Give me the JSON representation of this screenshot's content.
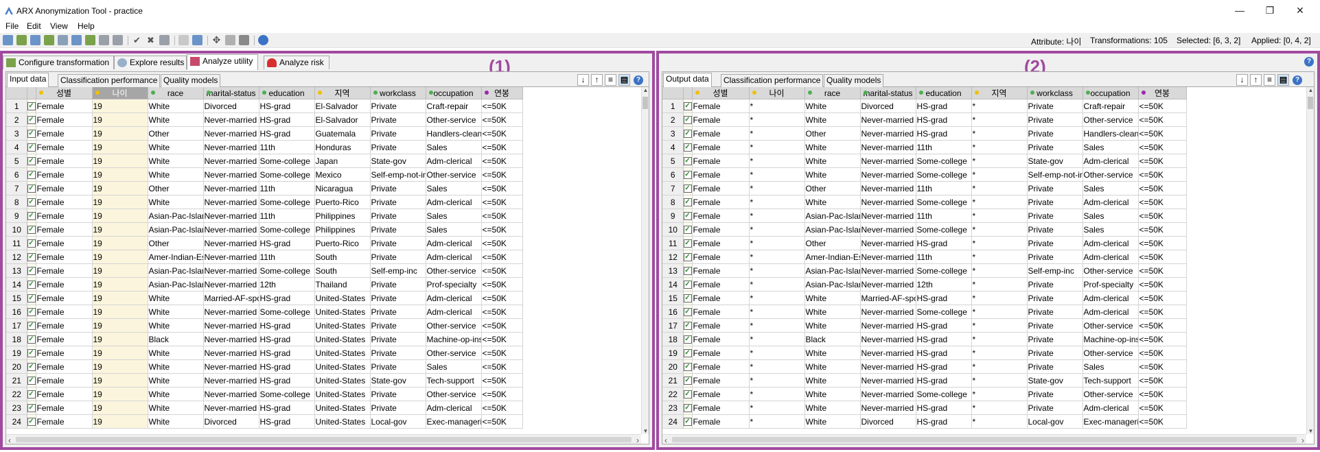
{
  "window": {
    "title": "ARX Anonymization Tool - practice"
  },
  "menu": [
    "File",
    "Edit",
    "View",
    "Help"
  ],
  "status": {
    "attribute": "Attribute: 나이",
    "transformations": "Transformations: 105",
    "selected": "Selected: [6, 3, 2]",
    "applied": "Applied: [0, 4, 2]"
  },
  "tabs": [
    "Configure transformation",
    "Explore results",
    "Analyze utility",
    "Analyze risk"
  ],
  "left": {
    "label": "(1)",
    "subtabs": [
      "Input data",
      "Classification performance",
      "Quality models"
    ]
  },
  "right": {
    "label": "(2)",
    "subtabs": [
      "Output data",
      "Classification performance",
      "Quality models"
    ]
  },
  "columns": [
    "성별",
    "나이",
    "race",
    "marital-status",
    "education",
    "지역",
    "workclass",
    "occupation",
    "연봉"
  ],
  "column_dot_colors": [
    "#f0c000",
    "#f0c000",
    "#4caf50",
    "#4caf50",
    "#4caf50",
    "#f0c000",
    "#4caf50",
    "#4caf50",
    "#9c27b0"
  ],
  "input_rows": [
    [
      "Female",
      "19",
      "White",
      "Divorced",
      "HS-grad",
      "El-Salvador",
      "Private",
      "Craft-repair",
      "<=50K"
    ],
    [
      "Female",
      "19",
      "White",
      "Never-married",
      "HS-grad",
      "El-Salvador",
      "Private",
      "Other-service",
      "<=50K"
    ],
    [
      "Female",
      "19",
      "Other",
      "Never-married",
      "HS-grad",
      "Guatemala",
      "Private",
      "Handlers-cleaners",
      "<=50K"
    ],
    [
      "Female",
      "19",
      "White",
      "Never-married",
      "11th",
      "Honduras",
      "Private",
      "Sales",
      "<=50K"
    ],
    [
      "Female",
      "19",
      "White",
      "Never-married",
      "Some-college",
      "Japan",
      "State-gov",
      "Adm-clerical",
      "<=50K"
    ],
    [
      "Female",
      "19",
      "White",
      "Never-married",
      "Some-college",
      "Mexico",
      "Self-emp-not-inc",
      "Other-service",
      "<=50K"
    ],
    [
      "Female",
      "19",
      "Other",
      "Never-married",
      "11th",
      "Nicaragua",
      "Private",
      "Sales",
      "<=50K"
    ],
    [
      "Female",
      "19",
      "White",
      "Never-married",
      "Some-college",
      "Puerto-Rico",
      "Private",
      "Adm-clerical",
      "<=50K"
    ],
    [
      "Female",
      "19",
      "Asian-Pac-Island...",
      "Never-married",
      "11th",
      "Philippines",
      "Private",
      "Sales",
      "<=50K"
    ],
    [
      "Female",
      "19",
      "Asian-Pac-Island...",
      "Never-married",
      "Some-college",
      "Philippines",
      "Private",
      "Sales",
      "<=50K"
    ],
    [
      "Female",
      "19",
      "Other",
      "Never-married",
      "HS-grad",
      "Puerto-Rico",
      "Private",
      "Adm-clerical",
      "<=50K"
    ],
    [
      "Female",
      "19",
      "Amer-Indian-Esk...",
      "Never-married",
      "11th",
      "South",
      "Private",
      "Adm-clerical",
      "<=50K"
    ],
    [
      "Female",
      "19",
      "Asian-Pac-Island...",
      "Never-married",
      "Some-college",
      "South",
      "Self-emp-inc",
      "Other-service",
      "<=50K"
    ],
    [
      "Female",
      "19",
      "Asian-Pac-Island...",
      "Never-married",
      "12th",
      "Thailand",
      "Private",
      "Prof-specialty",
      "<=50K"
    ],
    [
      "Female",
      "19",
      "White",
      "Married-AF-spo...",
      "HS-grad",
      "United-States",
      "Private",
      "Adm-clerical",
      "<=50K"
    ],
    [
      "Female",
      "19",
      "White",
      "Never-married",
      "Some-college",
      "United-States",
      "Private",
      "Adm-clerical",
      "<=50K"
    ],
    [
      "Female",
      "19",
      "White",
      "Never-married",
      "HS-grad",
      "United-States",
      "Private",
      "Other-service",
      "<=50K"
    ],
    [
      "Female",
      "19",
      "Black",
      "Never-married",
      "HS-grad",
      "United-States",
      "Private",
      "Machine-op-ins...",
      "<=50K"
    ],
    [
      "Female",
      "19",
      "White",
      "Never-married",
      "HS-grad",
      "United-States",
      "Private",
      "Other-service",
      "<=50K"
    ],
    [
      "Female",
      "19",
      "White",
      "Never-married",
      "HS-grad",
      "United-States",
      "Private",
      "Sales",
      "<=50K"
    ],
    [
      "Female",
      "19",
      "White",
      "Never-married",
      "HS-grad",
      "United-States",
      "State-gov",
      "Tech-support",
      "<=50K"
    ],
    [
      "Female",
      "19",
      "White",
      "Never-married",
      "Some-college",
      "United-States",
      "Private",
      "Other-service",
      "<=50K"
    ],
    [
      "Female",
      "19",
      "White",
      "Never-married",
      "HS-grad",
      "United-States",
      "Private",
      "Adm-clerical",
      "<=50K"
    ],
    [
      "Female",
      "19",
      "White",
      "Divorced",
      "HS-grad",
      "United-States",
      "Local-gov",
      "Exec-managerial",
      "<=50K"
    ]
  ],
  "output_rows": [
    [
      "Female",
      "*",
      "White",
      "Divorced",
      "HS-grad",
      "*",
      "Private",
      "Craft-repair",
      "<=50K"
    ],
    [
      "Female",
      "*",
      "White",
      "Never-married",
      "HS-grad",
      "*",
      "Private",
      "Other-service",
      "<=50K"
    ],
    [
      "Female",
      "*",
      "Other",
      "Never-married",
      "HS-grad",
      "*",
      "Private",
      "Handlers-cleaners",
      "<=50K"
    ],
    [
      "Female",
      "*",
      "White",
      "Never-married",
      "11th",
      "*",
      "Private",
      "Sales",
      "<=50K"
    ],
    [
      "Female",
      "*",
      "White",
      "Never-married",
      "Some-college",
      "*",
      "State-gov",
      "Adm-clerical",
      "<=50K"
    ],
    [
      "Female",
      "*",
      "White",
      "Never-married",
      "Some-college",
      "*",
      "Self-emp-not-inc",
      "Other-service",
      "<=50K"
    ],
    [
      "Female",
      "*",
      "Other",
      "Never-married",
      "11th",
      "*",
      "Private",
      "Sales",
      "<=50K"
    ],
    [
      "Female",
      "*",
      "White",
      "Never-married",
      "Some-college",
      "*",
      "Private",
      "Adm-clerical",
      "<=50K"
    ],
    [
      "Female",
      "*",
      "Asian-Pac-Island...",
      "Never-married",
      "11th",
      "*",
      "Private",
      "Sales",
      "<=50K"
    ],
    [
      "Female",
      "*",
      "Asian-Pac-Island...",
      "Never-married",
      "Some-college",
      "*",
      "Private",
      "Sales",
      "<=50K"
    ],
    [
      "Female",
      "*",
      "Other",
      "Never-married",
      "HS-grad",
      "*",
      "Private",
      "Adm-clerical",
      "<=50K"
    ],
    [
      "Female",
      "*",
      "Amer-Indian-Esk...",
      "Never-married",
      "11th",
      "*",
      "Private",
      "Adm-clerical",
      "<=50K"
    ],
    [
      "Female",
      "*",
      "Asian-Pac-Island...",
      "Never-married",
      "Some-college",
      "*",
      "Self-emp-inc",
      "Other-service",
      "<=50K"
    ],
    [
      "Female",
      "*",
      "Asian-Pac-Island...",
      "Never-married",
      "12th",
      "*",
      "Private",
      "Prof-specialty",
      "<=50K"
    ],
    [
      "Female",
      "*",
      "White",
      "Married-AF-spo...",
      "HS-grad",
      "*",
      "Private",
      "Adm-clerical",
      "<=50K"
    ],
    [
      "Female",
      "*",
      "White",
      "Never-married",
      "Some-college",
      "*",
      "Private",
      "Adm-clerical",
      "<=50K"
    ],
    [
      "Female",
      "*",
      "White",
      "Never-married",
      "HS-grad",
      "*",
      "Private",
      "Other-service",
      "<=50K"
    ],
    [
      "Female",
      "*",
      "Black",
      "Never-married",
      "HS-grad",
      "*",
      "Private",
      "Machine-op-ins...",
      "<=50K"
    ],
    [
      "Female",
      "*",
      "White",
      "Never-married",
      "HS-grad",
      "*",
      "Private",
      "Other-service",
      "<=50K"
    ],
    [
      "Female",
      "*",
      "White",
      "Never-married",
      "HS-grad",
      "*",
      "Private",
      "Sales",
      "<=50K"
    ],
    [
      "Female",
      "*",
      "White",
      "Never-married",
      "HS-grad",
      "*",
      "State-gov",
      "Tech-support",
      "<=50K"
    ],
    [
      "Female",
      "*",
      "White",
      "Never-married",
      "Some-college",
      "*",
      "Private",
      "Other-service",
      "<=50K"
    ],
    [
      "Female",
      "*",
      "White",
      "Never-married",
      "HS-grad",
      "*",
      "Private",
      "Adm-clerical",
      "<=50K"
    ],
    [
      "Female",
      "*",
      "White",
      "Divorced",
      "HS-grad",
      "*",
      "Local-gov",
      "Exec-managerial",
      "<=50K"
    ]
  ]
}
